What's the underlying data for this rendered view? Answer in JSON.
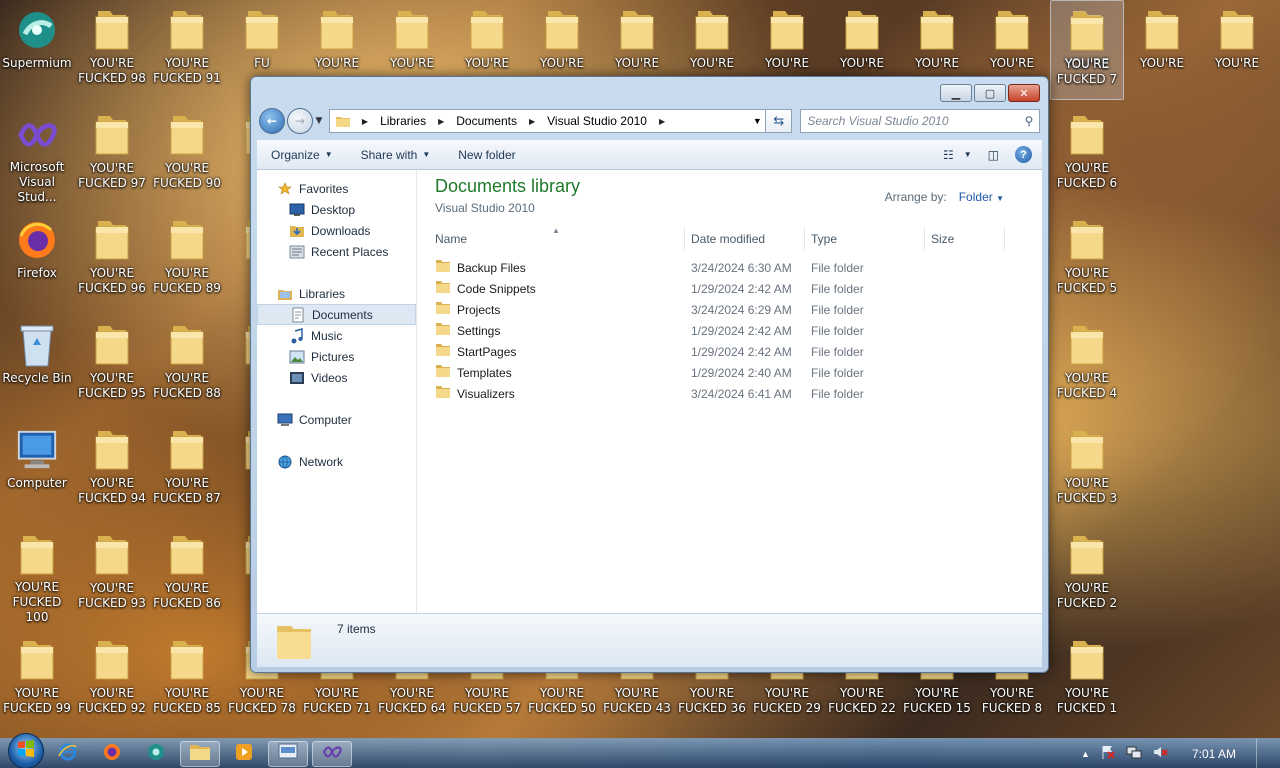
{
  "desktop": {
    "left_icons": [
      {
        "label": "Supermium",
        "icon": "supermium-icon"
      },
      {
        "label": "Microsoft Visual Stud...",
        "icon": "visual-studio-icon"
      },
      {
        "label": "Firefox",
        "icon": "firefox-icon"
      },
      {
        "label": "Recycle Bin",
        "icon": "recycle-bin-icon"
      },
      {
        "label": "Computer",
        "icon": "computer-icon"
      },
      {
        "label": "YOU'RE FUCKED 100",
        "icon": "folder-icon"
      },
      {
        "label": "YOU'RE FUCKED 99",
        "icon": "folder-icon"
      }
    ],
    "col2": [
      "YOU'RE FUCKED 98",
      "YOU'RE FUCKED 97",
      "YOU'RE FUCKED 96",
      "YOU'RE FUCKED 95",
      "YOU'RE FUCKED 94",
      "YOU'RE FUCKED 93",
      "YOU'RE FUCKED 92"
    ],
    "col3": [
      "YOU'RE FUCKED 91",
      "YOU'RE FUCKED 90",
      "YOU'RE FUCKED 89",
      "YOU'RE FUCKED 88",
      "YOU'RE FUCKED 87",
      "YOU'RE FUCKED 86",
      "YOU'RE FUCKED 85"
    ],
    "top_row_partial": [
      "YOU'RE",
      "YOU'RE",
      "YOU'RE",
      "YOU'RE",
      "YOU'RE",
      "YOU'RE",
      "YOU'RE",
      "YOU'RE",
      "YOU'RE",
      "YOU'RE",
      "YOU'RE",
      "YOU'RE",
      "YOU'RE"
    ],
    "bottom_row": [
      "YOU'RE FUCKED 78",
      "YOU'RE FUCKED 71",
      "YOU'RE FUCKED 64",
      "YOU'RE FUCKED 57",
      "YOU'RE FUCKED 50",
      "YOU'RE FUCKED 43",
      "YOU'RE FUCKED 36",
      "YOU'RE FUCKED 29",
      "YOU'RE FUCKED 22",
      "YOU'RE FUCKED 15",
      "YOU'RE FUCKED 8"
    ],
    "right_col": [
      "YOU'RE FUCKED 7",
      "YOU'RE FUCKED 6",
      "YOU'RE FUCKED 5",
      "YOU'RE FUCKED 4",
      "YOU'RE FUCKED 3",
      "YOU'RE FUCKED 2",
      "YOU'RE FUCKED 1"
    ],
    "partial_col": [
      "FU",
      "FU",
      "FU",
      "FU",
      "FU",
      "FU"
    ]
  },
  "window": {
    "breadcrumbs": [
      "Libraries",
      "Documents",
      "Visual Studio 2010"
    ],
    "search_placeholder": "Search Visual Studio 2010",
    "toolbar": {
      "organize": "Organize",
      "share_with": "Share with",
      "new_folder": "New folder"
    },
    "nav_pane": {
      "favorites": "Favorites",
      "desktop": "Desktop",
      "downloads": "Downloads",
      "recent_places": "Recent Places",
      "libraries": "Libraries",
      "documents": "Documents",
      "music": "Music",
      "pictures": "Pictures",
      "videos": "Videos",
      "computer": "Computer",
      "network": "Network"
    },
    "library_title": "Documents library",
    "library_subtitle": "Visual Studio 2010",
    "arrange_by_label": "Arrange by:",
    "arrange_by_value": "Folder",
    "columns": {
      "name": "Name",
      "date": "Date modified",
      "type": "Type",
      "size": "Size"
    },
    "files": [
      {
        "name": "Backup Files",
        "date": "3/24/2024 6:30 AM",
        "type": "File folder"
      },
      {
        "name": "Code Snippets",
        "date": "1/29/2024 2:42 AM",
        "type": "File folder"
      },
      {
        "name": "Projects",
        "date": "3/24/2024 6:29 AM",
        "type": "File folder"
      },
      {
        "name": "Settings",
        "date": "1/29/2024 2:42 AM",
        "type": "File folder"
      },
      {
        "name": "StartPages",
        "date": "1/29/2024 2:42 AM",
        "type": "File folder"
      },
      {
        "name": "Templates",
        "date": "1/29/2024 2:40 AM",
        "type": "File folder"
      },
      {
        "name": "Visualizers",
        "date": "3/24/2024 6:41 AM",
        "type": "File folder"
      }
    ],
    "item_count": "7 items"
  },
  "taskbar": {
    "clock": "7:01 AM"
  },
  "colors": {
    "library_title": "#1e7a2a",
    "accent_link": "#1d5aa8",
    "folder": "#f2d27a"
  }
}
